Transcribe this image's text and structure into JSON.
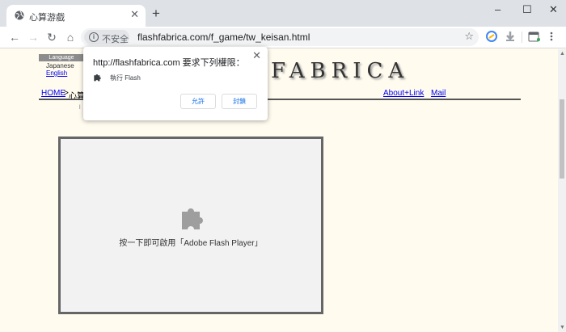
{
  "browser": {
    "tab_title": "心算游戲",
    "tab_close": "✕",
    "new_tab": "+",
    "window_controls": {
      "minimize": "–",
      "maximize": "☐",
      "close": "✕"
    },
    "nav": {
      "back": "←",
      "forward": "→",
      "reload": "↻",
      "home": "⌂"
    },
    "security_label": "不安全",
    "url": "flashfabrica.com/f_game/tw_keisan.html",
    "bookmark_star": "☆"
  },
  "page": {
    "language_header": "Language",
    "language_japanese": "Japanese",
    "language_english": "English",
    "logo_text": "FABRICA",
    "breadcrumb_home": "HOME",
    "breadcrumb_sep": ">",
    "breadcrumb_current": "心算",
    "link_about": "About+Link",
    "link_mail": "Mail",
    "small_mark": "l",
    "flash_prompt": "按一下即可啟用「Adobe Flash Player」"
  },
  "popup": {
    "title": "http://flashfabrica.com 要求下列權限：",
    "permission": "執行 Flash",
    "allow": "允許",
    "block": "封鎖",
    "close": "✕"
  },
  "colors": {
    "page_bg": "#fffbef",
    "link": "#0000ee",
    "popup_button_text": "#1a73e8"
  }
}
